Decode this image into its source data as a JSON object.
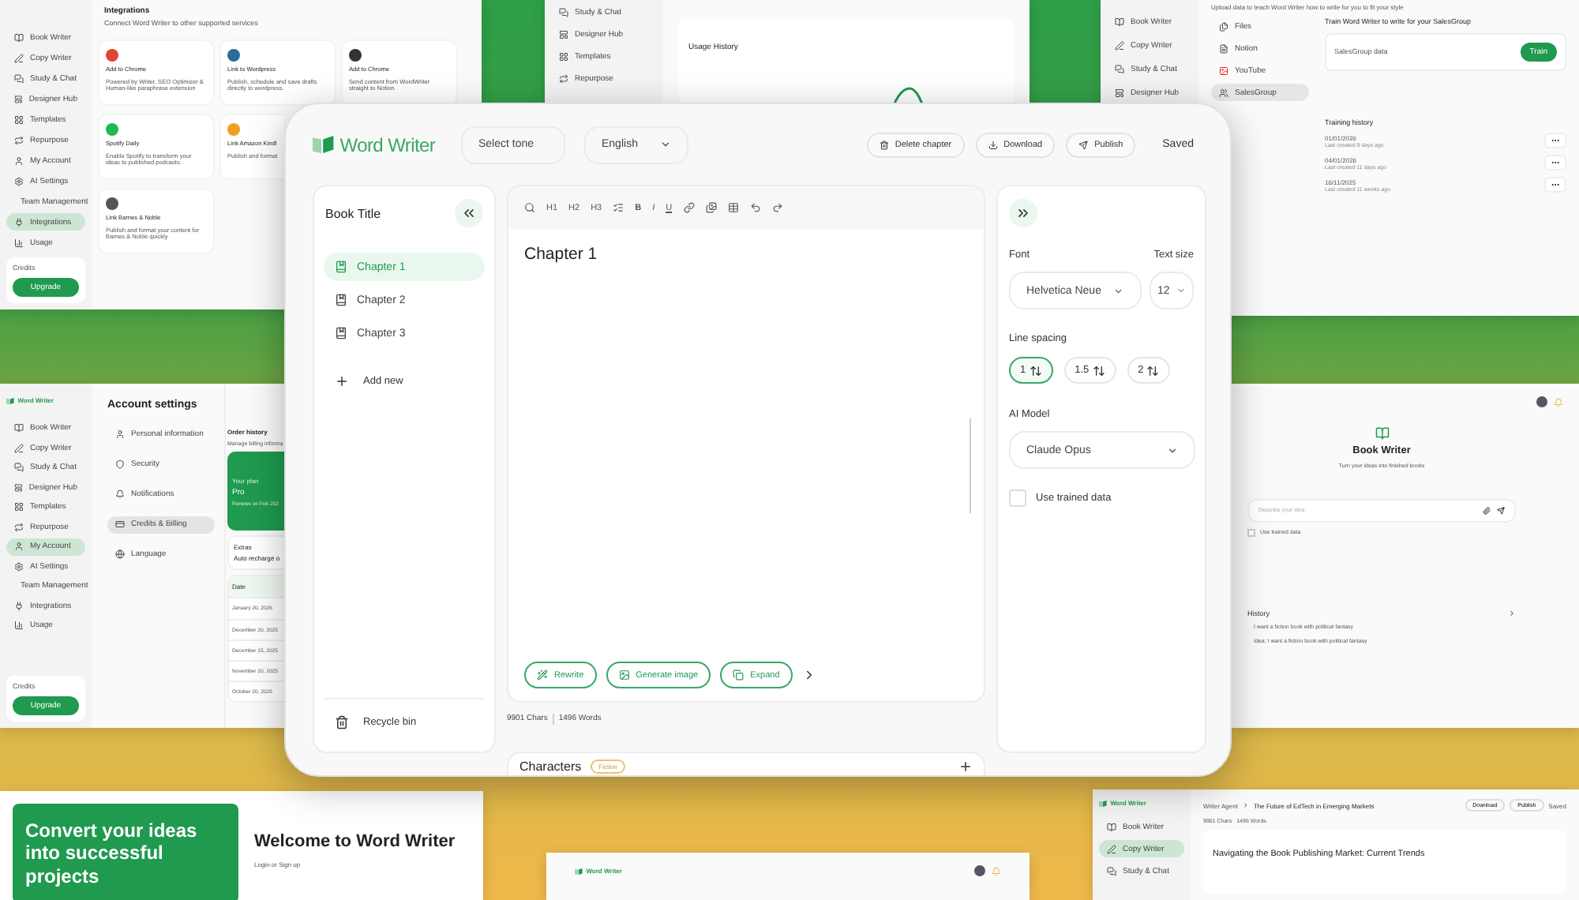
{
  "integrations_page": {
    "nav": [
      {
        "label": "Book Writer",
        "selected": false
      },
      {
        "label": "Copy Writer",
        "selected": false
      },
      {
        "label": "Study & Chat",
        "selected": false
      },
      {
        "label": "Designer Hub",
        "selected": false
      },
      {
        "label": "Templates",
        "selected": false
      },
      {
        "label": "Repurpose",
        "selected": false
      },
      {
        "label": "My Account",
        "selected": false
      },
      {
        "label": "AI Settings",
        "selected": false
      },
      {
        "label": "Team Management",
        "selected": false
      },
      {
        "label": "Integrations",
        "selected": true
      },
      {
        "label": "Usage",
        "selected": false
      }
    ],
    "credits_label": "Credits",
    "upgrade": "Upgrade",
    "title": "Integrations",
    "subtitle": "Connect Word Writer to other supported services",
    "cards": [
      {
        "title": "Add to Chrome",
        "text": "Powered by Writer, SEO Optimizer & Human-like paraphrase extension",
        "color": "#e2442f"
      },
      {
        "title": "Link to Wordpress",
        "text": "Publish, schedule and save drafts directly to wordpress.",
        "color": "#2d6b9a"
      },
      {
        "title": "Add to Chrome",
        "text": "Send content from WordWriter straight to Notion.",
        "color": "#333333"
      },
      {
        "title": "Spotify Daily",
        "text": "Enable Spotify to transform your ideas to published podcasts.",
        "color": "#1db954"
      },
      {
        "title": "Link Amazon Kindl",
        "text": "Publish and format",
        "color": "#f0a020"
      },
      {
        "title": "Link Barnes & Noble",
        "text": "Publish and format your content for Barnes & Noble quickly",
        "color": "#555555"
      }
    ]
  },
  "usage_page": {
    "nav": [
      {
        "label": "Study & Chat",
        "selected": false
      },
      {
        "label": "Designer Hub",
        "selected": false
      },
      {
        "label": "Templates",
        "selected": false
      },
      {
        "label": "Repurpose",
        "selected": false
      }
    ],
    "chart_title": "Usage History"
  },
  "training_page": {
    "nav": [
      {
        "label": "Book Writer",
        "selected": false
      },
      {
        "label": "Copy Writer",
        "selected": false
      },
      {
        "label": "Study & Chat",
        "selected": false
      },
      {
        "label": "Designer Hub",
        "selected": false
      }
    ],
    "intro": "Upload data to teach Word Writer how to write for you to fit your style",
    "sources": [
      {
        "label": "Files",
        "selected": false
      },
      {
        "label": "Notion",
        "selected": false
      },
      {
        "label": "YouTube",
        "selected": false
      },
      {
        "label": "SalesGroup",
        "selected": true
      }
    ],
    "train_heading": "Train Word Writer to write for your SalesGroup",
    "data_name": "SalesGroup data",
    "train_button": "Train",
    "history_title": "Training history",
    "history": [
      {
        "date": "01/01/2026",
        "note": "Last created 9 days ago"
      },
      {
        "date": "04/01/2026",
        "note": "Last created 11 days ago"
      },
      {
        "date": "16/11/2025",
        "note": "Last created 11 weeks ago"
      }
    ]
  },
  "account_page": {
    "logo": "Word Writer",
    "nav": [
      {
        "label": "Book Writer",
        "selected": false
      },
      {
        "label": "Copy Writer",
        "selected": false
      },
      {
        "label": "Study & Chat",
        "selected": false
      },
      {
        "label": "Designer Hub",
        "selected": false
      },
      {
        "label": "Templates",
        "selected": false
      },
      {
        "label": "Repurpose",
        "selected": false
      },
      {
        "label": "My Account",
        "selected": true
      },
      {
        "label": "AI Settings",
        "selected": false
      },
      {
        "label": "Team Management",
        "selected": false
      },
      {
        "label": "Integrations",
        "selected": false
      },
      {
        "label": "Usage",
        "selected": false
      }
    ],
    "credits_label": "Credits",
    "upgrade": "Upgrade",
    "title": "Account settings",
    "tabs": [
      {
        "label": "Personal information",
        "selected": false
      },
      {
        "label": "Security",
        "selected": false
      },
      {
        "label": "Notifications",
        "selected": false
      },
      {
        "label": "Credits & Billing",
        "selected": true
      },
      {
        "label": "Language",
        "selected": false
      }
    ],
    "order_title": "Order history",
    "order_subtitle": "Manage billing informa",
    "plan_label": "Your plan",
    "plan": "Pro",
    "plan_note": "Renews on Feb 202",
    "extras_label": "Extras",
    "extras_value": "Auto recharge o",
    "date_header": "Date",
    "dates": [
      "January 20, 2026",
      "December 20, 2025",
      "December 15, 2025",
      "November 20, 2025",
      "October 20, 2025"
    ]
  },
  "book_writer_page": {
    "title": "Book Writer",
    "subtitle": "Turn your ideas into finished books",
    "placeholder": "Describe your idea",
    "trained_label": "Use trained data",
    "trained_checked": false,
    "history_title": "History",
    "history": [
      "I want a fiction book with political fantasy",
      "Idea: I want a fiction book with political fantasy"
    ]
  },
  "welcome_page": {
    "hero": "Convert your ideas into successful projects",
    "title": "Welcome to Word Writer",
    "subtitle": "Login or Sign up"
  },
  "dashboard_page": {
    "logo": "Word Writer"
  },
  "copy_page": {
    "logo": "Word Writer",
    "nav": [
      {
        "label": "Book Writer",
        "selected": false
      },
      {
        "label": "Copy Writer",
        "selected": true
      },
      {
        "label": "Study & Chat",
        "selected": false
      }
    ],
    "breadcrumb": [
      "Writer Agent",
      "The Future of EdTech in Emerging Markets"
    ],
    "actions": [
      "Download",
      "Publish"
    ],
    "status": "Saved",
    "chars": "9901 Chars",
    "words": "1496 Words",
    "heading": "Navigating the Book Publishing Market: Current Trends"
  },
  "editor": {
    "logo": "Word Writer",
    "tone": "Select tone",
    "language": "English",
    "actions": [
      "Delete chapter",
      "Download",
      "Publish"
    ],
    "status": "Saved",
    "book_title": "Book Title",
    "chapters": [
      {
        "label": "Chapter 1",
        "selected": true
      },
      {
        "label": "Chapter 2",
        "selected": false
      },
      {
        "label": "Chapter 3",
        "selected": false
      }
    ],
    "add_new": "Add new",
    "recycle_bin": "Recycle bin",
    "toolbar": [
      {
        "kind": "icon"
      },
      {
        "kind": "text",
        "label": "H1"
      },
      {
        "kind": "text",
        "label": "H2"
      },
      {
        "kind": "text",
        "label": "H3"
      },
      {
        "kind": "icon"
      },
      {
        "kind": "text",
        "label": "B"
      },
      {
        "kind": "text",
        "label": "I"
      },
      {
        "kind": "text",
        "label": "U"
      },
      {
        "kind": "icon"
      },
      {
        "kind": "icon"
      },
      {
        "kind": "icon"
      },
      {
        "kind": "icon"
      },
      {
        "kind": "icon"
      }
    ],
    "chapter_heading": "Chapter 1",
    "ai_actions": [
      "Rewrite",
      "Generate image",
      "Expand"
    ],
    "chars": "9901 Chars",
    "words": "1496 Words",
    "characters_title": "Characters",
    "characters_tag": "Fiction",
    "font_label": "Font",
    "font": "Helvetica Neue",
    "size_label": "Text size",
    "size": "12",
    "spacing_label": "Line spacing",
    "spacings": [
      {
        "label": "1",
        "selected": true
      },
      {
        "label": "1.5",
        "selected": false
      },
      {
        "label": "2",
        "selected": false
      }
    ],
    "model_label": "AI Model",
    "model": "Claude Opus",
    "trained_label": "Use trained data",
    "trained_checked": false
  }
}
